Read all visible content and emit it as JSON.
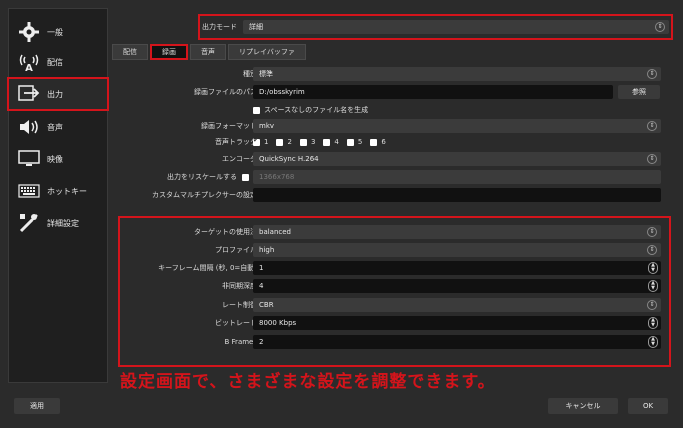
{
  "sidebar": {
    "items": [
      {
        "label": "一般",
        "icon": "gear-icon"
      },
      {
        "label": "配信",
        "icon": "broadcast-icon"
      },
      {
        "label": "出力",
        "icon": "output-icon"
      },
      {
        "label": "音声",
        "icon": "speaker-icon"
      },
      {
        "label": "映像",
        "icon": "monitor-icon"
      },
      {
        "label": "ホットキー",
        "icon": "keyboard-icon"
      },
      {
        "label": "詳細設定",
        "icon": "tools-icon"
      }
    ]
  },
  "output_mode": {
    "label": "出力モード",
    "value": "詳細"
  },
  "tabs": [
    "配信",
    "録画",
    "音声",
    "リプレイバッファ"
  ],
  "recording": {
    "type": {
      "label": "種別",
      "value": "標準"
    },
    "path": {
      "label": "録画ファイルのパス",
      "value": "D:/obsskyrim",
      "browse": "参照"
    },
    "no_space": {
      "label": "スペースなしのファイル名を生成"
    },
    "format": {
      "label": "録画フォーマット",
      "value": "mkv"
    },
    "audio_track": {
      "label": "音声トラック",
      "tracks": [
        "1",
        "2",
        "3",
        "4",
        "5",
        "6"
      ]
    },
    "encoder": {
      "label": "エンコーダ",
      "value": "QuickSync H.264"
    },
    "rescale": {
      "label": "出力をリスケールする",
      "value": "1366x768"
    },
    "muxer": {
      "label": "カスタムマルチプレクサーの設定",
      "value": ""
    }
  },
  "encoder_settings": {
    "target_usage": {
      "label": "ターゲットの使用法",
      "value": "balanced"
    },
    "profile": {
      "label": "プロファイル",
      "value": "high"
    },
    "keyframe": {
      "label": "キーフレーム間隔 (秒, 0=自動)",
      "value": "1"
    },
    "async_depth": {
      "label": "非同期深度",
      "value": "4"
    },
    "rate_control": {
      "label": "レート制御",
      "value": "CBR"
    },
    "bitrate": {
      "label": "ビットレート",
      "value": "8000 Kbps"
    },
    "b_frames": {
      "label": "B Frames",
      "value": "2"
    }
  },
  "caption": "設定画面で、さまざまな設定を調整できます。",
  "buttons": {
    "apply": "適用",
    "cancel": "キャンセル",
    "ok": "OK"
  }
}
